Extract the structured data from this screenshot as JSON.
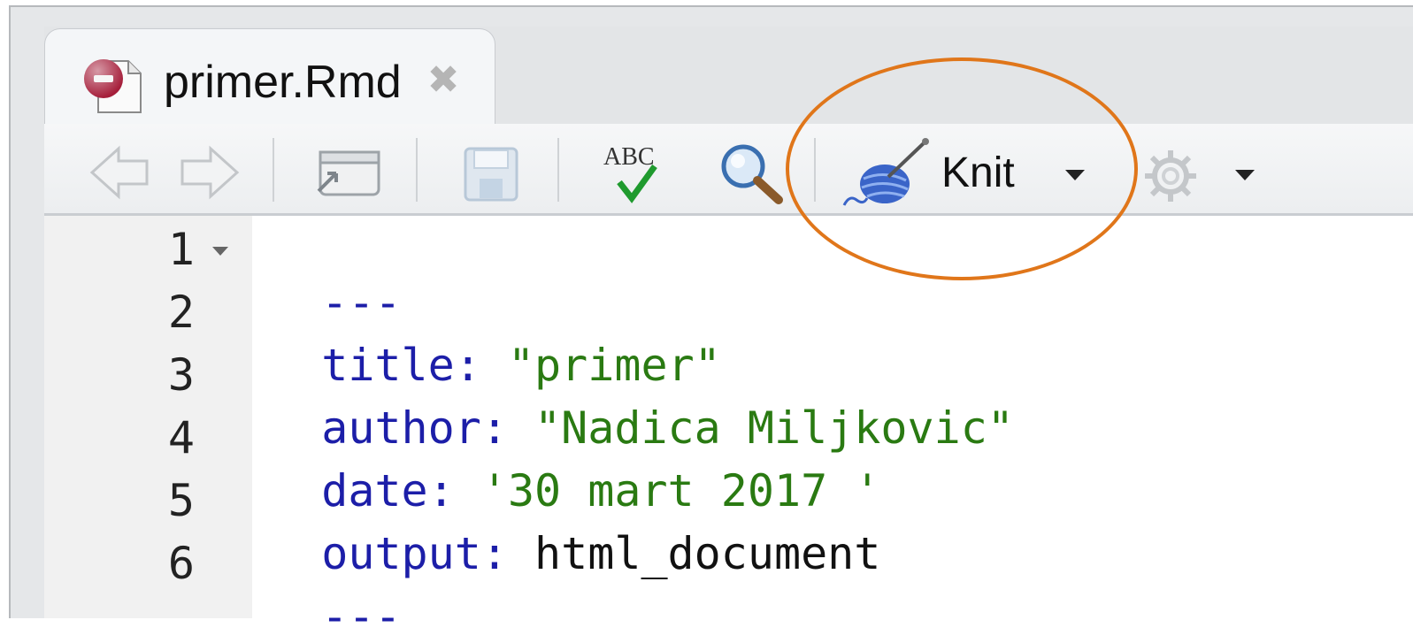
{
  "tab": {
    "filename": "primer.Rmd",
    "close_glyph": "✖"
  },
  "toolbar": {
    "icons": [
      "back-arrow-icon",
      "forward-arrow-icon",
      "show-in-window-icon",
      "save-icon",
      "spellcheck-icon",
      "find-icon",
      "knit-icon",
      "gear-icon"
    ],
    "spellcheck_text": "ABC",
    "knit_label": "Knit"
  },
  "editor": {
    "line_numbers": [
      "1",
      "2",
      "3",
      "4",
      "5",
      "6"
    ],
    "lines": [
      {
        "key": "---",
        "value": ""
      },
      {
        "key": "title:",
        "value": "\"primer\""
      },
      {
        "key": "author:",
        "value": "\"Nadica Miljkovic\""
      },
      {
        "key": "date:",
        "value": "'30 mart 2017 '"
      },
      {
        "key": "output:",
        "value": "html_document"
      },
      {
        "key": "---",
        "value": ""
      }
    ]
  },
  "colors": {
    "yaml_key": "#1c1ea8",
    "string": "#2a7a12",
    "highlight_ring": "#e0761a"
  }
}
